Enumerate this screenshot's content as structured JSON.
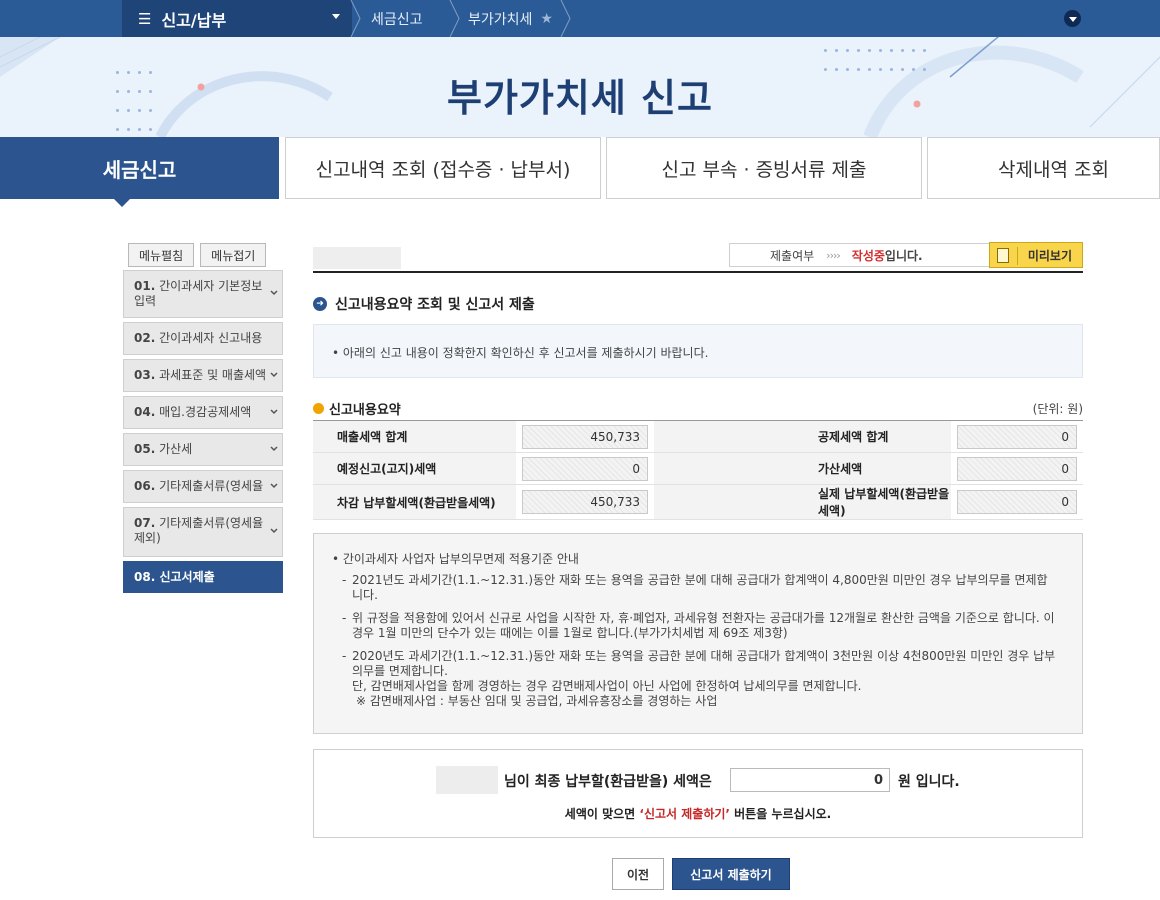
{
  "topbar": {
    "menu_title": "신고/납부",
    "crumbs": [
      "세금신고",
      "부가가치세"
    ]
  },
  "banner": {
    "title": "부가가치세 신고"
  },
  "tabs": [
    "세금신고",
    "신고내역 조회 (접수증 · 납부서)",
    "신고 부속 · 증빙서류 제출",
    "삭제내역 조회"
  ],
  "sidebar": {
    "expand_label": "메뉴펼침",
    "collapse_label": "메뉴접기",
    "items": [
      {
        "num": "01.",
        "label": "간이과세자 기본정보 입력"
      },
      {
        "num": "02.",
        "label": "간이과세자 신고내용"
      },
      {
        "num": "03.",
        "label": "과세표준 및 매출세액"
      },
      {
        "num": "04.",
        "label": "매입.경감공제세액"
      },
      {
        "num": "05.",
        "label": "가산세"
      },
      {
        "num": "06.",
        "label": "기타제출서류(영세율"
      },
      {
        "num": "07.",
        "label": "기타제출서류(영세율 제외)"
      },
      {
        "num": "08.",
        "label": "신고서제출"
      }
    ]
  },
  "status": {
    "label": "제출여부",
    "arrows": "››››",
    "state": "작성중",
    "suffix": "입니다.",
    "preview": "미리보기"
  },
  "section": {
    "title": "신고내용요약 조회 및 신고서 제출",
    "notice": "• 아래의 신고 내용이 정확한지 확인하신 후 신고서를 제출하시기 바랍니다."
  },
  "summary": {
    "title": "신고내용요약",
    "unit": "(단위: 원)",
    "rows": [
      {
        "label1": "매출세액 합계",
        "value1": "450,733",
        "label2": "공제세액 합계",
        "value2": "0"
      },
      {
        "label1": "예정신고(고지)세액",
        "value1": "0",
        "label2": "가산세액",
        "value2": "0"
      },
      {
        "label1": "차감 납부할세액(환급받을세액)",
        "value1": "450,733",
        "label2": "실제 납부할세액(환급받을세액)",
        "value2": "0"
      }
    ]
  },
  "guide": {
    "title": "• 간이과세자 사업자 납부의무면제 적용기준 안내",
    "items": [
      "2021년도 과세기간(1.1.~12.31.)동안 재화 또는 용역을 공급한 분에 대해 공급대가 합계액이 4,800만원 미만인 경우 납부의무를 면제합니다.",
      "위 규정을 적용함에 있어서 신규로 사업을 시작한 자, 휴·폐업자, 과세유형 전환자는 공급대가를 12개월로 환산한 금액을 기준으로 합니다. 이 경우 1월 미만의 단수가 있는 때에는 이를 1월로 합니다.(부가가치세법 제 69조 제3항)",
      "2020년도 과세기간(1.1.~12.31.)동안 재화 또는 용역을 공급한 분에 대해 공급대가 합계액이 3천만원 이상 4천800만원 미만인 경우 납부의무를 면제합니다."
    ],
    "extra1": "단, 감면배제사업을 함께 경영하는 경우 감면배제사업이 아닌 사업에 한정하여 납세의무를 면제합니다.",
    "extra2": "※ 감면배제사업 : 부동산 임대 및 공급업, 과세유흥장소를 경영하는 사업"
  },
  "final": {
    "prefix": "님이 최종 납부할(환급받을) 세액은",
    "amount": "0",
    "suffix": "원 입니다.",
    "hint_pre": "세액이 맞으면 ",
    "hint_red": "‘신고서 제출하기’",
    "hint_post": " 버튼을 누르십시오."
  },
  "buttons": {
    "prev": "이전",
    "submit": "신고서 제출하기"
  }
}
